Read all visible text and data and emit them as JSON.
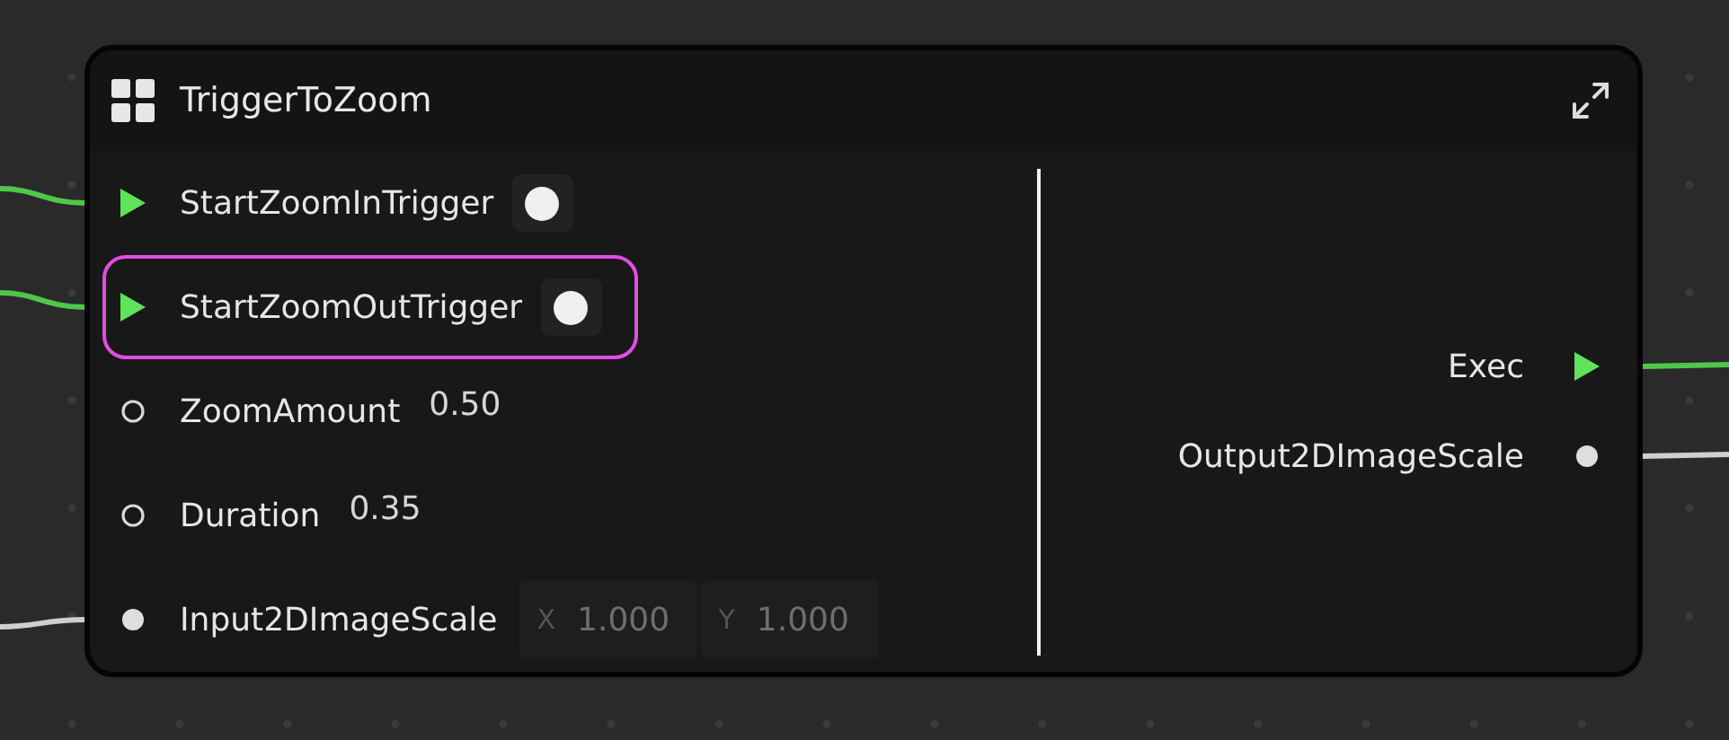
{
  "node": {
    "title": "TriggerToZoom",
    "inputs": [
      {
        "kind": "exec",
        "label": "StartZoomInTrigger",
        "connected": true,
        "selected": false
      },
      {
        "kind": "exec",
        "label": "StartZoomOutTrigger",
        "connected": true,
        "selected": true
      },
      {
        "kind": "param",
        "label": "ZoomAmount",
        "value": "0.50",
        "connected": false,
        "selected": false
      },
      {
        "kind": "param",
        "label": "Duration",
        "value": "0.35",
        "connected": false,
        "selected": false
      },
      {
        "kind": "vector",
        "label": "Input2DImageScale",
        "fields": [
          {
            "axis": "X",
            "value": "1.000"
          },
          {
            "axis": "Y",
            "value": "1.000"
          }
        ],
        "connected": true,
        "selected": false
      }
    ],
    "outputs": [
      {
        "kind": "exec",
        "label": "Exec",
        "connected": true
      },
      {
        "kind": "vector",
        "label": "Output2DImageScale",
        "connected": true
      }
    ]
  }
}
